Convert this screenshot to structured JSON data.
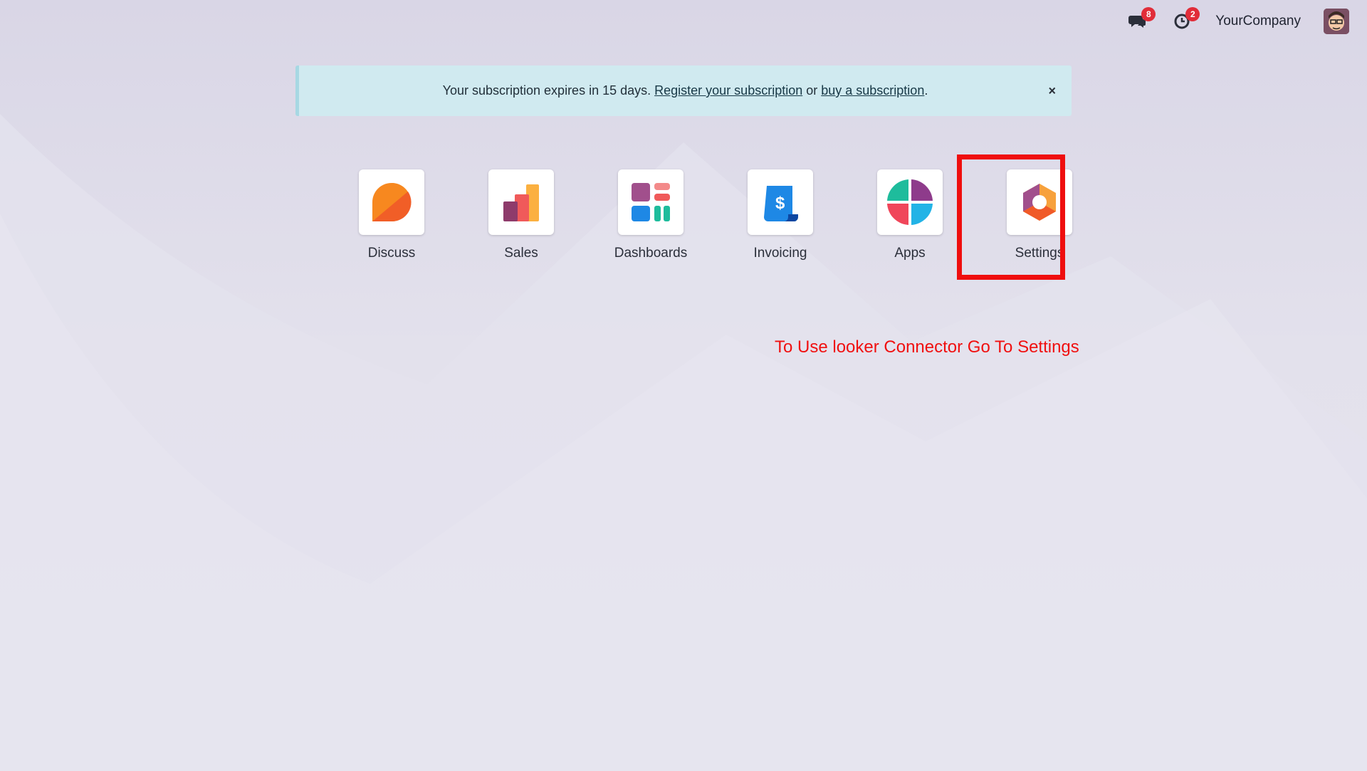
{
  "topbar": {
    "messages_badge": "8",
    "activities_badge": "2",
    "company": "YourCompany"
  },
  "alert": {
    "text_before": "Your subscription expires in 15 days. ",
    "register_link": "Register your subscription",
    "text_or": " or ",
    "buy_link": "buy a subscription",
    "text_after": ".",
    "close_label": "×"
  },
  "apps": [
    {
      "label": "Discuss",
      "icon": "discuss-icon"
    },
    {
      "label": "Sales",
      "icon": "sales-icon"
    },
    {
      "label": "Dashboards",
      "icon": "dashboards-icon"
    },
    {
      "label": "Invoicing",
      "icon": "invoicing-icon"
    },
    {
      "label": "Apps",
      "icon": "apps-icon"
    },
    {
      "label": "Settings",
      "icon": "settings-icon"
    }
  ],
  "annotation": {
    "text": "To Use looker Connector Go To Settings",
    "color": "#ef0e0e"
  }
}
